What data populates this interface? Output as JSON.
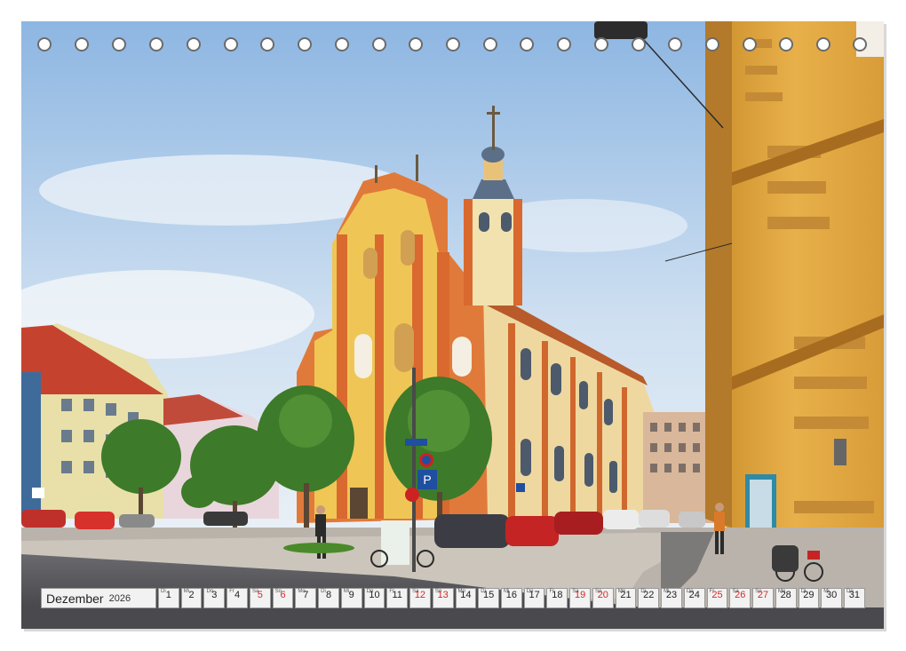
{
  "calendar": {
    "month": "Dezember",
    "year": "2026",
    "days": [
      {
        "n": "1",
        "w": "Di",
        "we": false
      },
      {
        "n": "2",
        "w": "Mi",
        "we": false
      },
      {
        "n": "3",
        "w": "Do",
        "we": false
      },
      {
        "n": "4",
        "w": "Fr",
        "we": false
      },
      {
        "n": "5",
        "w": "Sa",
        "we": true
      },
      {
        "n": "6",
        "w": "So",
        "we": true
      },
      {
        "n": "7",
        "w": "Mo",
        "we": false
      },
      {
        "n": "8",
        "w": "Di",
        "we": false
      },
      {
        "n": "9",
        "w": "Mi",
        "we": false
      },
      {
        "n": "10",
        "w": "Do",
        "we": false
      },
      {
        "n": "11",
        "w": "Fr",
        "we": false
      },
      {
        "n": "12",
        "w": "Sa",
        "we": true
      },
      {
        "n": "13",
        "w": "So",
        "we": true
      },
      {
        "n": "14",
        "w": "Mo",
        "we": false
      },
      {
        "n": "15",
        "w": "Di",
        "we": false
      },
      {
        "n": "16",
        "w": "Mi",
        "we": false
      },
      {
        "n": "17",
        "w": "Do",
        "we": false
      },
      {
        "n": "18",
        "w": "Fr",
        "we": false
      },
      {
        "n": "19",
        "w": "Sa",
        "we": true
      },
      {
        "n": "20",
        "w": "So",
        "we": true
      },
      {
        "n": "21",
        "w": "Mo",
        "we": false
      },
      {
        "n": "22",
        "w": "Di",
        "we": false
      },
      {
        "n": "23",
        "w": "Mi",
        "we": false
      },
      {
        "n": "24",
        "w": "Do",
        "we": false
      },
      {
        "n": "25",
        "w": "Fr",
        "we": true
      },
      {
        "n": "26",
        "w": "Sa",
        "we": true
      },
      {
        "n": "27",
        "w": "So",
        "we": true
      },
      {
        "n": "28",
        "w": "Mo",
        "we": false
      },
      {
        "n": "29",
        "w": "Di",
        "we": false
      },
      {
        "n": "30",
        "w": "Mi",
        "we": false
      },
      {
        "n": "31",
        "w": "Do",
        "we": false
      }
    ]
  },
  "photo": {
    "sign_text": "P",
    "colors": {
      "sky_top": "#9cc0e6",
      "sky_bottom": "#e9f1f8",
      "church": "#e07a3a",
      "facade_yellow": "#f0c44a",
      "building_right": "#e8b04a",
      "road": "#4a4a4e",
      "trees": "#3d7a2a"
    }
  }
}
